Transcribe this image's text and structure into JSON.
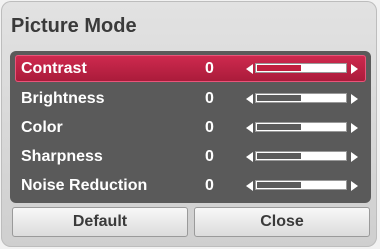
{
  "dialog": {
    "title": "Picture Mode",
    "items": [
      {
        "label": "Contrast",
        "value": "0",
        "level": 0.5,
        "selected": true
      },
      {
        "label": "Brightness",
        "value": "0",
        "level": 0.5,
        "selected": false
      },
      {
        "label": "Color",
        "value": "0",
        "level": 0.5,
        "selected": false
      },
      {
        "label": "Sharpness",
        "value": "0",
        "level": 0.5,
        "selected": false
      },
      {
        "label": "Noise Reduction",
        "value": "0",
        "level": 0.5,
        "selected": false
      }
    ],
    "buttons": {
      "default_label": "Default",
      "close_label": "Close"
    }
  },
  "colors": {
    "selected_row": "#c0203f",
    "panel": "#5a5a5a"
  }
}
